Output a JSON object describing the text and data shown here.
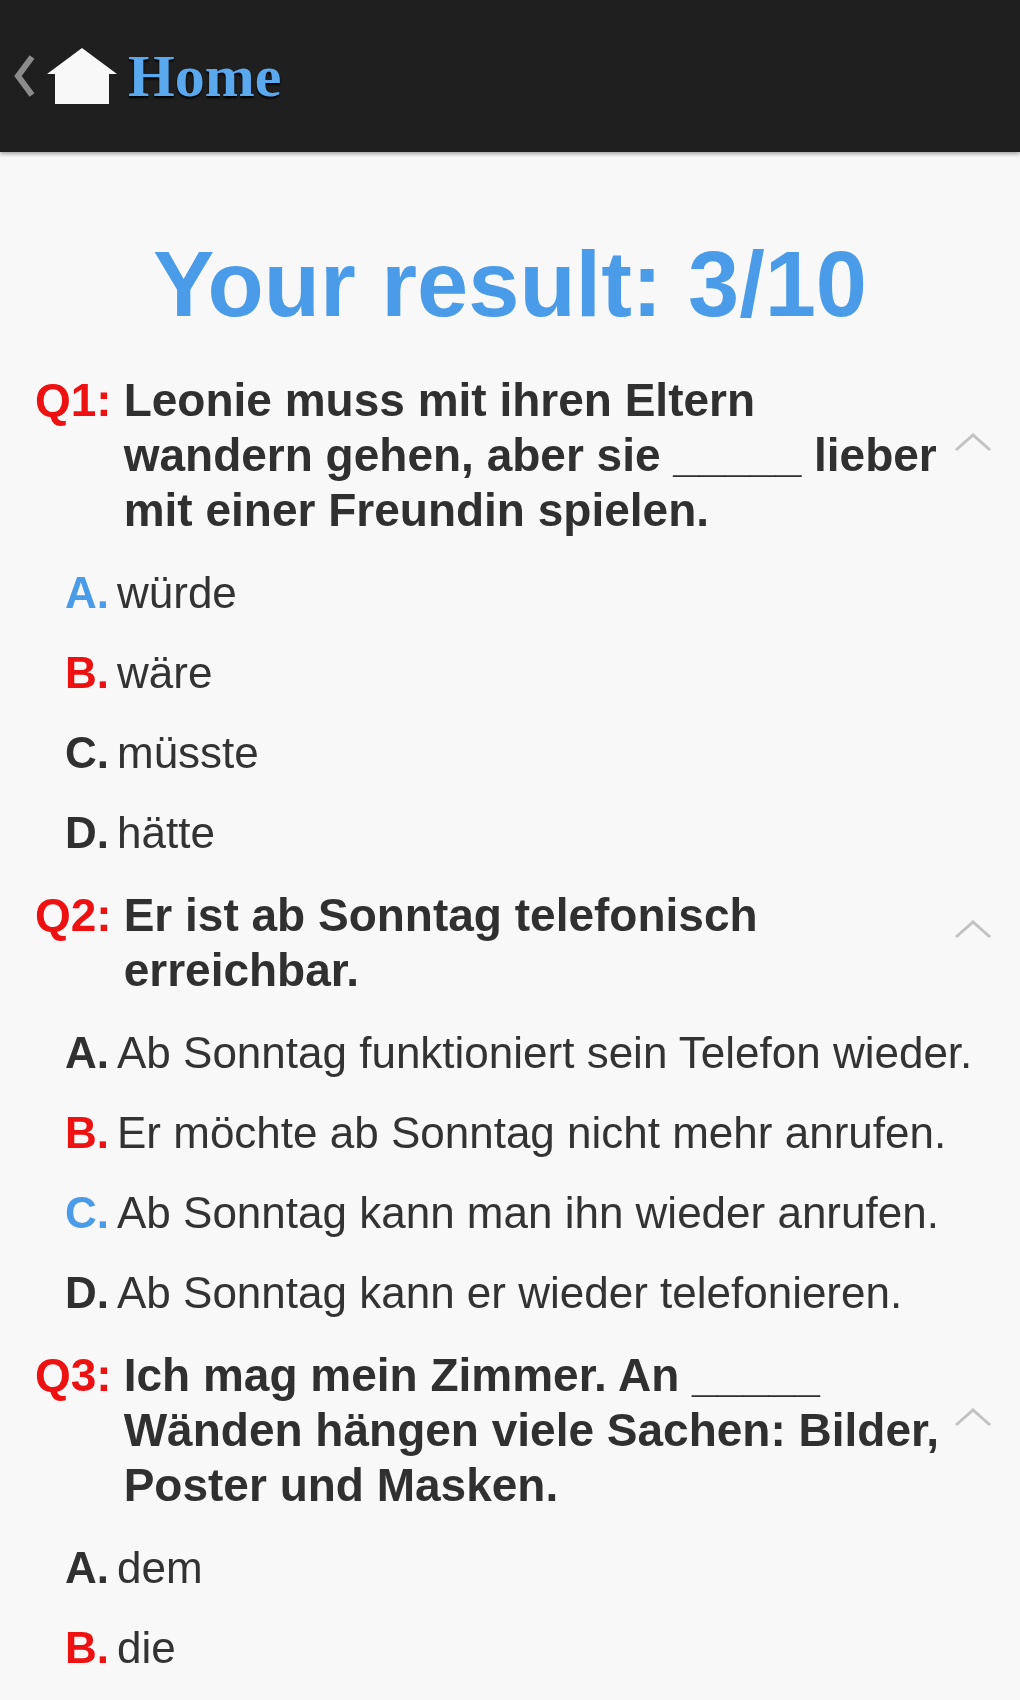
{
  "action_bar": {
    "title": "Home"
  },
  "result": "Your result: 3/10",
  "questions": [
    {
      "number": "Q1:",
      "text": "Leonie muss mit ihren Eltern wandern gehen, aber sie _____ lieber mit einer Freundin spielen.",
      "expanded": true,
      "options": [
        {
          "letter": "A.",
          "text": "würde",
          "correct": true,
          "selected": false
        },
        {
          "letter": "B.",
          "text": "wäre",
          "correct": false,
          "selected": true
        },
        {
          "letter": "C.",
          "text": "müsste",
          "correct": false,
          "selected": false
        },
        {
          "letter": "D.",
          "text": "hätte",
          "correct": false,
          "selected": false
        }
      ]
    },
    {
      "number": "Q2:",
      "text": "Er ist ab Sonntag telefonisch erreichbar.",
      "expanded": true,
      "options": [
        {
          "letter": "A.",
          "text": "Ab Sonntag funktioniert sein Telefon wieder.",
          "correct": false,
          "selected": false
        },
        {
          "letter": "B.",
          "text": "Er möchte ab Sonntag nicht mehr anrufen.",
          "correct": false,
          "selected": true
        },
        {
          "letter": "C.",
          "text": "Ab Sonntag kann man ihn wieder anrufen.",
          "correct": true,
          "selected": false
        },
        {
          "letter": "D.",
          "text": "Ab Sonntag kann er wieder telefonieren.",
          "correct": false,
          "selected": false
        }
      ]
    },
    {
      "number": "Q3:",
      "text": "Ich mag mein Zimmer. An _____ Wänden hängen viele Sachen: Bilder, Poster und Masken.",
      "expanded": true,
      "options": [
        {
          "letter": "A.",
          "text": "dem",
          "correct": false,
          "selected": false
        },
        {
          "letter": "B.",
          "text": "die",
          "correct": false,
          "selected": true
        }
      ]
    }
  ]
}
